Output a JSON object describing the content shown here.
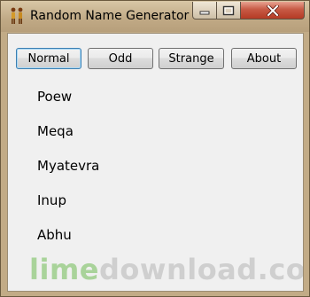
{
  "window": {
    "title": "Random Name Generator",
    "app_icon": "figures-icon",
    "controls": [
      "minimize-icon",
      "maximize-icon",
      "close-icon"
    ]
  },
  "toolbar": {
    "buttons": [
      {
        "label": "Normal",
        "focused": true
      },
      {
        "label": "Odd",
        "focused": false
      },
      {
        "label": "Strange",
        "focused": false
      },
      {
        "label": "About",
        "focused": false
      }
    ]
  },
  "names": [
    "Poew",
    "Meqa",
    "Myatevra",
    "Inup",
    "Abhu"
  ],
  "watermark": {
    "part1": "lime",
    "part2": "download.com"
  },
  "colors": {
    "frame": "#c2ab86",
    "client_bg": "#f0f0f0",
    "close_button": "#c75a45",
    "watermark_green": "#a9d39a",
    "watermark_gray": "#cfcfcf"
  }
}
